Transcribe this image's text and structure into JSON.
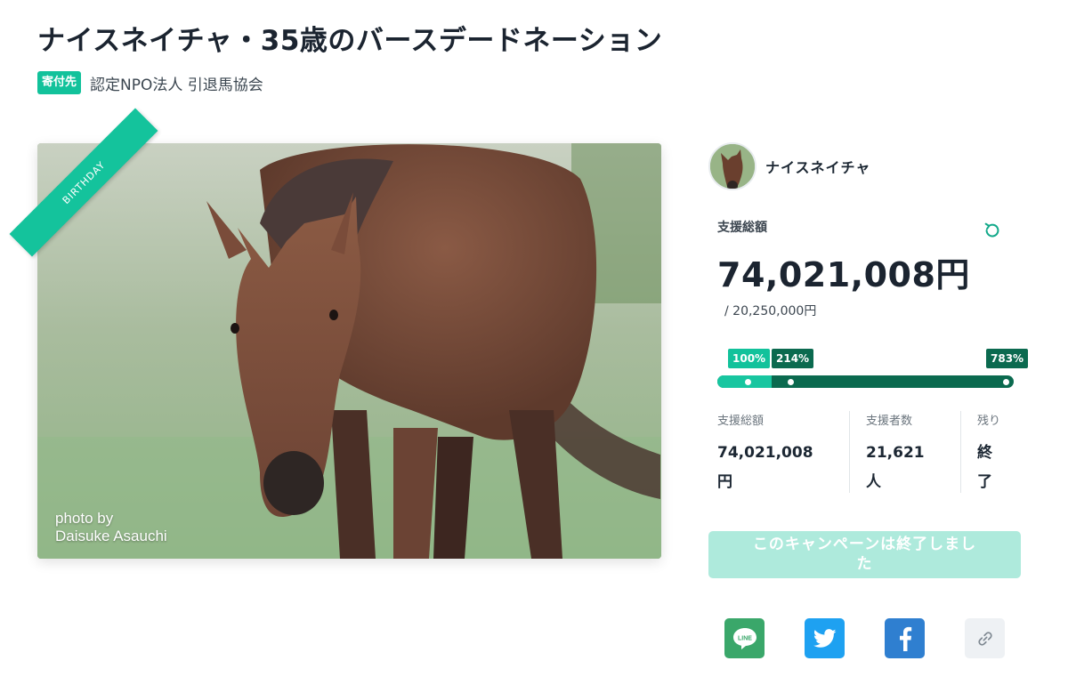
{
  "page": {
    "title": "ナイスネイチャ・35歳のバースデードネーション"
  },
  "org": {
    "badge": "寄付先",
    "name": "認定NPO法人 引退馬協会"
  },
  "photo": {
    "ribbon": "BIRTHDAY",
    "credit_line1": "photo by",
    "credit_line2": "Daisuke Asauchi"
  },
  "owner": {
    "name": "ナイスネイチャ"
  },
  "funding": {
    "total_label": "支援総額",
    "total_amount": "74,021,008円",
    "goal": "/ 20,250,000円",
    "progress_fraction": 0.183,
    "milestones": [
      {
        "label": "100%",
        "color": "#12c29b"
      },
      {
        "label": "214%",
        "color": "#0b6a4f"
      },
      {
        "label": "783%",
        "color": "#0b6a4f"
      }
    ]
  },
  "stats": [
    {
      "label": "支援総額",
      "value_line1": "74,021,008",
      "value_line2": "円"
    },
    {
      "label": "支援者数",
      "value_line1": "21,621",
      "value_line2": "人"
    },
    {
      "label": "残り",
      "value_line1": "終",
      "value_line2": "了"
    }
  ],
  "status": {
    "ended_line1": "このキャンペーンは終了しまし",
    "ended_line2": "た"
  },
  "share": {
    "line_label": "LINE",
    "colors": {
      "line": "#3aa76a",
      "twitter": "#1ea1f1",
      "facebook": "#2f7fd0",
      "link": "#eef1f4"
    },
    "icons": [
      "line-icon",
      "twitter-icon",
      "facebook-icon",
      "link-icon"
    ]
  },
  "colors": {
    "accent": "#12c29b",
    "dark_green": "#0b6a4f",
    "ended_bg": "#aeeadc"
  }
}
